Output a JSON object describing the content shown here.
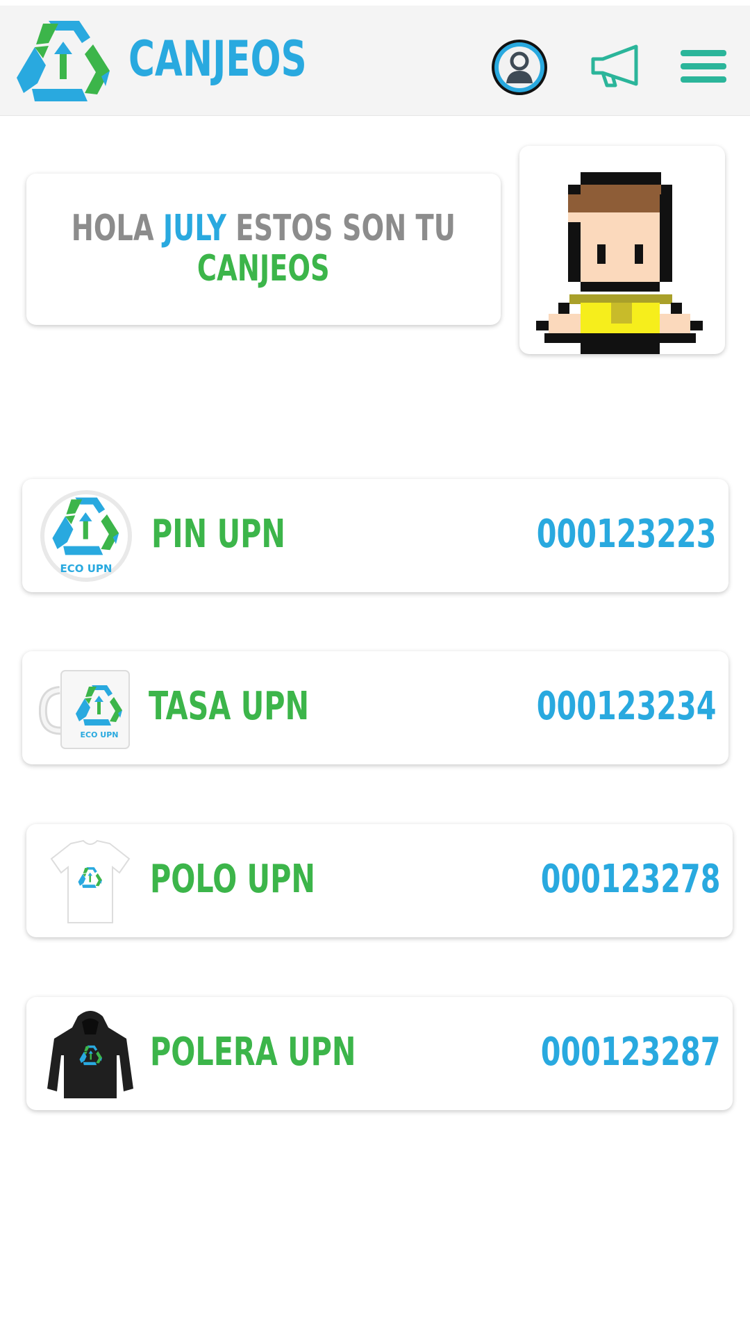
{
  "header": {
    "title": "CANJEOS",
    "icons": [
      "recycle-logo",
      "profile-icon",
      "megaphone-icon",
      "hamburger-menu-icon"
    ]
  },
  "greeting": {
    "hola": "HOLA",
    "name": "JULY",
    "rest": "ESTOS SON TU",
    "highlight": "CANJEOS"
  },
  "items": [
    {
      "name": "PIN UPN",
      "code": "000123223",
      "image": "pin-eco-upn"
    },
    {
      "name": "TASA UPN",
      "code": "000123234",
      "image": "mug-eco-upn"
    },
    {
      "name": "POLO UPN",
      "code": "000123278",
      "image": "tshirt-eco-upn"
    },
    {
      "name": "POLERA UPN",
      "code": "000123287",
      "image": "hoodie-eco-upn"
    }
  ],
  "badge_text": "ECO UPN",
  "colors": {
    "brand_blue": "#29a9df",
    "brand_green": "#3cb54a",
    "text_grey": "#8c8c8c",
    "header_bg": "#f4f4f4",
    "menu_teal": "#2bb59a"
  }
}
